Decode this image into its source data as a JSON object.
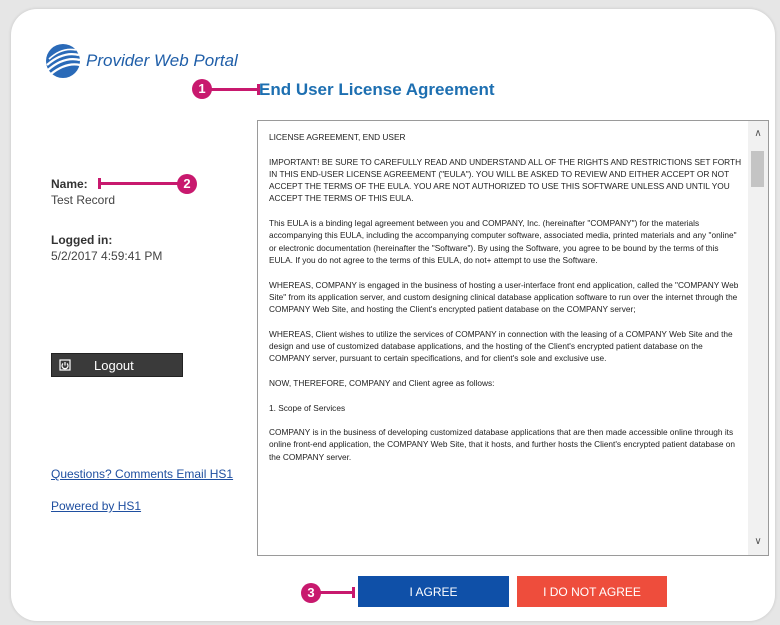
{
  "app": {
    "brand": "Provider Web Portal"
  },
  "header": {
    "title": "End User License Agreement"
  },
  "callouts": [
    "1",
    "2",
    "3"
  ],
  "sidebar": {
    "name_label": "Name:",
    "name_value": "Test Record",
    "logged_label": "Logged in:",
    "logged_value": "5/2/2017 4:59:41 PM",
    "logout_label": "Logout",
    "logout_icon": "power-icon",
    "questions_link": "Questions? Comments Email HS1",
    "powered_link": "Powered by HS1"
  },
  "eula": {
    "paragraphs": [
      "LICENSE AGREEMENT, END USER",
      "IMPORTANT! BE SURE TO CAREFULLY READ AND UNDERSTAND ALL OF THE RIGHTS AND RESTRICTIONS SET FORTH IN THIS END-USER LICENSE AGREEMENT (\"EULA\"). YOU WILL BE ASKED TO REVIEW AND EITHER ACCEPT OR NOT ACCEPT THE TERMS OF THE EULA. YOU ARE NOT AUTHORIZED TO USE THIS SOFTWARE UNLESS AND UNTIL YOU ACCEPT THE TERMS OF THIS EULA.",
      "This EULA is a binding legal agreement between you and COMPANY, Inc. (hereinafter \"COMPANY\") for the materials accompanying this EULA, including the accompanying computer software, associated media, printed materials and any \"online\" or electronic documentation (hereinafter the \"Software\"). By using the Software, you agree to be bound by the terms of this EULA. If you do not agree to the terms of this EULA, do not+ attempt to use the Software.",
      "WHEREAS, COMPANY is engaged in the business of hosting a user-interface front end application, called the \"COMPANY Web Site\" from its application server, and custom designing clinical database application software to run over the internet through the COMPANY Web Site, and hosting the Client's encrypted patient database on the COMPANY server;",
      "WHEREAS, Client wishes to utilize the services of COMPANY in connection with the leasing of a COMPANY Web Site and the design and use of customized database applications, and the hosting of the Client's encrypted patient database on the COMPANY server, pursuant to certain specifications, and for client's sole and exclusive use.",
      "NOW, THEREFORE, COMPANY and Client agree as follows:",
      "1. Scope of Services",
      "COMPANY is in the business of developing customized database applications that are then made accessible online through its online front-end application, the COMPANY Web Site, that it hosts, and further hosts the Client's encrypted patient database on the COMPANY server."
    ]
  },
  "actions": {
    "agree_label": "I AGREE",
    "disagree_label": "I DO NOT AGREE"
  },
  "colors": {
    "accent": "#c8196e",
    "primary": "#0f50a8",
    "danger": "#ee4d3c",
    "title": "#1d6fb1"
  }
}
